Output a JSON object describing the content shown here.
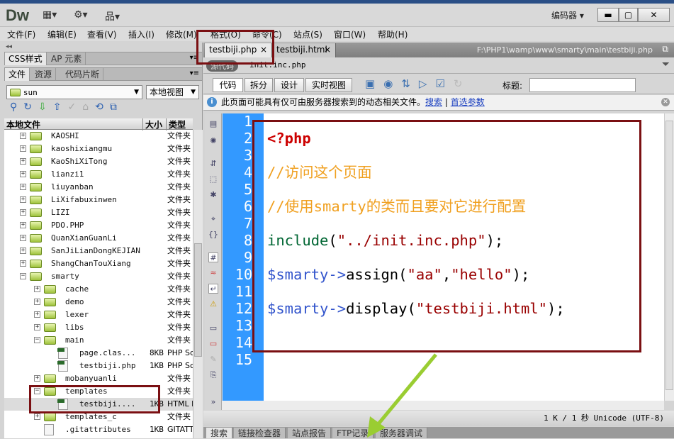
{
  "app": {
    "logo": "Dw",
    "workspace": "编码器",
    "layout_icon": "▦▾",
    "gear_icon": "⚙▾",
    "site_icon": "品▾",
    "min": "▬",
    "max": "▢",
    "close": "✕"
  },
  "menu": [
    "文件(F)",
    "编辑(E)",
    "查看(V)",
    "插入(I)",
    "修改(M)",
    "格式(O)",
    "命令(C)",
    "站点(S)",
    "窗口(W)",
    "帮助(H)"
  ],
  "left": {
    "collapse": "◂◂",
    "panel_tabs": [
      "CSS样式",
      "AP 元素"
    ],
    "file_tabs": [
      "文件",
      "资源",
      "代码片断"
    ],
    "site": "sun",
    "view": "本地视图",
    "headers": {
      "name": "本地文件",
      "size": "大小",
      "type": "类型"
    },
    "rows": [
      {
        "name": "KAOSHI",
        "level": 1,
        "kind": "folder",
        "exp": "+",
        "size": "",
        "type": "文件夹"
      },
      {
        "name": "kaoshixiangmu",
        "level": 1,
        "kind": "folder",
        "exp": "+",
        "size": "",
        "type": "文件夹"
      },
      {
        "name": "KaoShiXiTong",
        "level": 1,
        "kind": "folder",
        "exp": "+",
        "size": "",
        "type": "文件夹"
      },
      {
        "name": "lianzi1",
        "level": 1,
        "kind": "folder",
        "exp": "+",
        "size": "",
        "type": "文件夹"
      },
      {
        "name": "liuyanban",
        "level": 1,
        "kind": "folder",
        "exp": "+",
        "size": "",
        "type": "文件夹"
      },
      {
        "name": "LiXifabuxinwen",
        "level": 1,
        "kind": "folder",
        "exp": "+",
        "size": "",
        "type": "文件夹"
      },
      {
        "name": "LIZI",
        "level": 1,
        "kind": "folder",
        "exp": "+",
        "size": "",
        "type": "文件夹"
      },
      {
        "name": "PDO.PHP",
        "level": 1,
        "kind": "folder",
        "exp": "+",
        "size": "",
        "type": "文件夹"
      },
      {
        "name": "QuanXianGuanLi",
        "level": 1,
        "kind": "folder",
        "exp": "+",
        "size": "",
        "type": "文件夹"
      },
      {
        "name": "SanJiLianDongKEJIAN",
        "level": 1,
        "kind": "folder",
        "exp": "+",
        "size": "",
        "type": "文件夹"
      },
      {
        "name": "ShangChanTouXiang",
        "level": 1,
        "kind": "folder",
        "exp": "+",
        "size": "",
        "type": "文件夹"
      },
      {
        "name": "smarty",
        "level": 1,
        "kind": "folder",
        "exp": "−",
        "size": "",
        "type": "文件夹"
      },
      {
        "name": "cache",
        "level": 2,
        "kind": "folder",
        "exp": "+",
        "size": "",
        "type": "文件夹"
      },
      {
        "name": "demo",
        "level": 2,
        "kind": "folder",
        "exp": "+",
        "size": "",
        "type": "文件夹"
      },
      {
        "name": "lexer",
        "level": 2,
        "kind": "folder",
        "exp": "+",
        "size": "",
        "type": "文件夹"
      },
      {
        "name": "libs",
        "level": 2,
        "kind": "folder",
        "exp": "+",
        "size": "",
        "type": "文件夹"
      },
      {
        "name": "main",
        "level": 2,
        "kind": "folder",
        "exp": "−",
        "size": "",
        "type": "文件夹"
      },
      {
        "name": "page.clas...",
        "level": 3,
        "kind": "php",
        "exp": "",
        "size": "8KB",
        "type": "PHP Script"
      },
      {
        "name": "testbiji.php",
        "level": 3,
        "kind": "php",
        "exp": "",
        "size": "1KB",
        "type": "PHP Script"
      },
      {
        "name": "mobanyuanli",
        "level": 2,
        "kind": "folder",
        "exp": "+",
        "size": "",
        "type": "文件夹"
      },
      {
        "name": "templates",
        "level": 2,
        "kind": "folder",
        "exp": "−",
        "size": "",
        "type": "文件夹"
      },
      {
        "name": "testbiji....",
        "level": 3,
        "kind": "php",
        "exp": "",
        "size": "1KB",
        "type": "HTML Document",
        "selected": true
      },
      {
        "name": "templates_c",
        "level": 2,
        "kind": "folder",
        "exp": "+",
        "size": "",
        "type": "文件夹"
      },
      {
        "name": ".gitattributes",
        "level": 2,
        "kind": "file",
        "exp": "",
        "size": "1KB",
        "type": "GITATTRIBUTES"
      }
    ]
  },
  "doc": {
    "tabs": [
      {
        "label": "testbiji.php",
        "close": "×",
        "active": true
      },
      {
        "label": "testbiji.html",
        "close": "×",
        "active": false
      }
    ],
    "path": "F:\\PHP1\\wamp\\www\\smarty\\main\\testbiji.php",
    "source_code": "源代码",
    "related_file": "init.inc.php",
    "views": [
      "代码",
      "拆分",
      "设计",
      "实时视图"
    ],
    "title_label": "标题:",
    "title_value": "",
    "info": "此页面可能具有仅可由服务器搜索到的动态相关文件。",
    "info_link1": "搜索",
    "info_sep": "|",
    "info_link2": "首选参数",
    "line_numbers": [
      "1",
      "2",
      "3",
      "4",
      "5",
      "6",
      "7",
      "8",
      "9",
      "10",
      "11",
      "12",
      "13",
      "14",
      "15"
    ],
    "code": [
      [],
      [
        {
          "t": "<?php",
          "c": "#cc0000",
          "b": true
        }
      ],
      [],
      [
        {
          "t": "//访问这个页面",
          "c": "#f0a020"
        }
      ],
      [],
      [
        {
          "t": "//使用smarty的类而且要对它进行配置",
          "c": "#f0a020"
        }
      ],
      [],
      [
        {
          "t": "include",
          "c": "#006633"
        },
        {
          "t": "(",
          "c": "#000"
        },
        {
          "t": "\"../init.inc.php\"",
          "c": "#990000"
        },
        {
          "t": ");",
          "c": "#000"
        }
      ],
      [],
      [
        {
          "t": "$smarty",
          "c": "#3355cc"
        },
        {
          "t": "->",
          "c": "#3355cc"
        },
        {
          "t": "assign",
          "c": "#000"
        },
        {
          "t": "(",
          "c": "#000"
        },
        {
          "t": "\"aa\"",
          "c": "#990000"
        },
        {
          "t": ",",
          "c": "#000"
        },
        {
          "t": "\"hello\"",
          "c": "#990000"
        },
        {
          "t": ");",
          "c": "#000"
        }
      ],
      [],
      [
        {
          "t": "$smarty",
          "c": "#3355cc"
        },
        {
          "t": "->",
          "c": "#3355cc"
        },
        {
          "t": "display",
          "c": "#000"
        },
        {
          "t": "(",
          "c": "#000"
        },
        {
          "t": "\"testbiji.html\"",
          "c": "#990000"
        },
        {
          "t": ");",
          "c": "#000"
        }
      ],
      [],
      [],
      []
    ],
    "status": "1 K / 1 秒 Unicode (UTF-8)"
  },
  "bottom_tabs": [
    "搜索",
    "链接检查器",
    "站点报告",
    "FTP记录",
    "服务器调试"
  ],
  "colors": {
    "gutter": "#3399ff",
    "annotation": "#7a0f12",
    "arrow": "#9acd32"
  }
}
